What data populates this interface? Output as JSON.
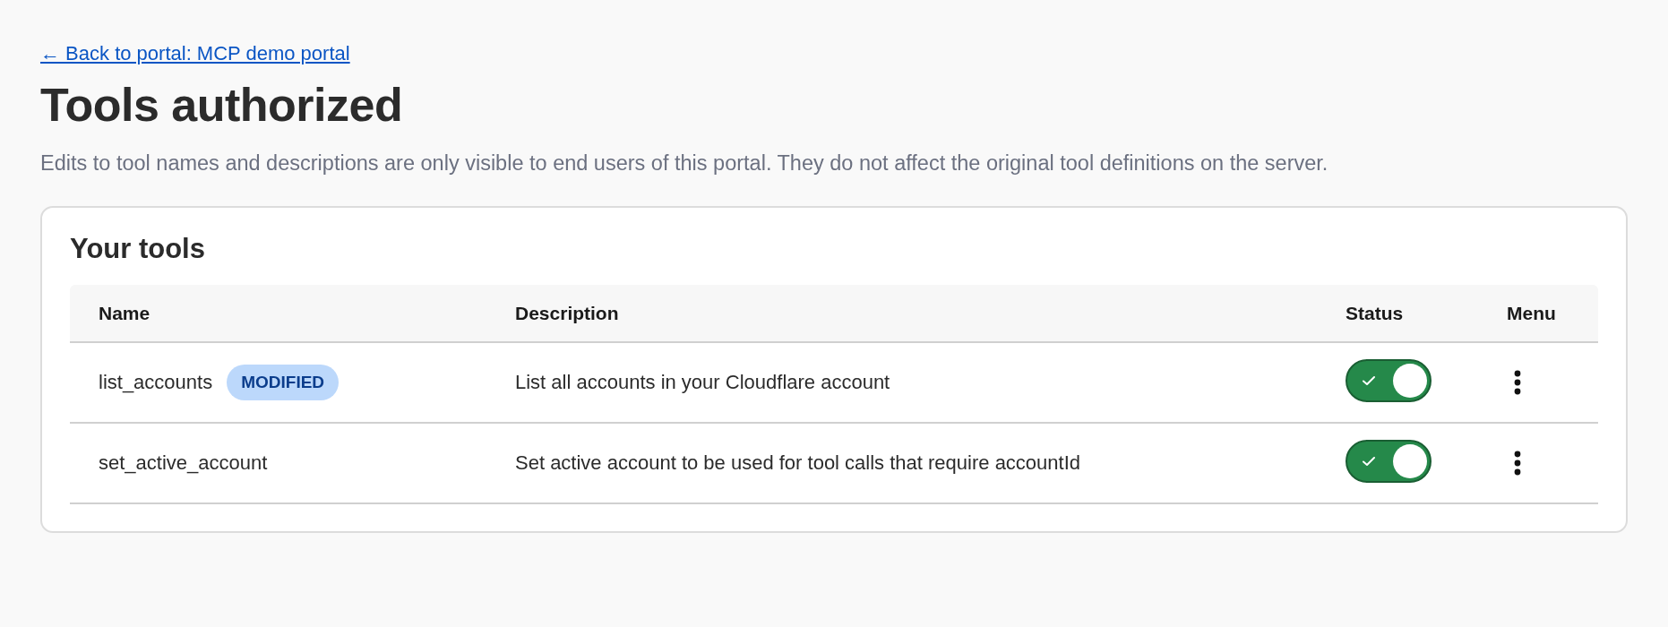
{
  "back_link": "← Back to portal: MCP demo portal",
  "title": "Tools authorized",
  "description": "Edits to tool names and descriptions are only visible to end users of this portal. They do not affect the original tool definitions on the server.",
  "card": {
    "title": "Your tools",
    "table": {
      "columns": [
        "Name",
        "Description",
        "Status",
        "Menu"
      ],
      "rows": [
        {
          "name": "list_accounts",
          "badge": "MODIFIED",
          "description": "List all accounts in your Cloudflare account",
          "status": {
            "checked": true
          }
        },
        {
          "name": "set_active_account",
          "description": "Set active account to be used for tool calls that require accountId",
          "status": {
            "checked": true
          }
        }
      ]
    }
  }
}
